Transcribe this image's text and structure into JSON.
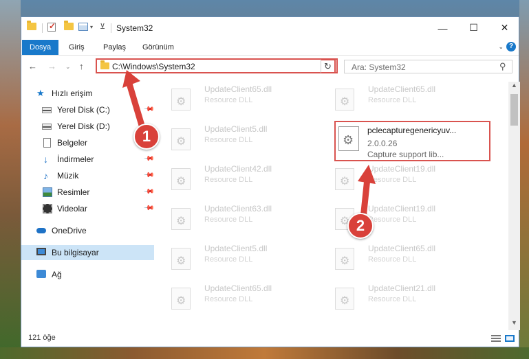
{
  "window": {
    "title": "System32",
    "minimize": "—",
    "maximize": "☐",
    "close": "✕"
  },
  "ribbon": {
    "tabs": [
      "Dosya",
      "Giriş",
      "Paylaş",
      "Görünüm"
    ],
    "help": "?"
  },
  "nav": {
    "address": "C:\\Windows\\System32",
    "search_placeholder": "Ara: System32"
  },
  "sidebar": {
    "items": [
      {
        "label": "Hızlı erişim",
        "icon": "star-icon"
      },
      {
        "label": "Yerel Disk (C:)",
        "icon": "drive-icon",
        "pinned": true
      },
      {
        "label": "Yerel Disk (D:)",
        "icon": "drive-icon",
        "pinned": false
      },
      {
        "label": "Belgeler",
        "icon": "document-icon",
        "pinned": false
      },
      {
        "label": "İndirmeler",
        "icon": "download-icon",
        "pinned": true
      },
      {
        "label": "Müzik",
        "icon": "music-icon",
        "pinned": true
      },
      {
        "label": "Resimler",
        "icon": "pictures-icon",
        "pinned": true
      },
      {
        "label": "Videolar",
        "icon": "videos-icon",
        "pinned": true
      },
      {
        "label": "OneDrive",
        "icon": "cloud-icon"
      },
      {
        "label": "Bu bilgisayar",
        "icon": "computer-icon",
        "selected": true
      },
      {
        "label": "Ağ",
        "icon": "network-icon"
      }
    ]
  },
  "files": {
    "left": [
      {
        "name": "UpdateClient65.dll",
        "type": "Resource DLL"
      },
      {
        "name": "UpdateClient5.dll",
        "type": "Resource DLL"
      },
      {
        "name": "UpdateClient42.dll",
        "type": "Resource DLL"
      },
      {
        "name": "UpdateClient63.dll",
        "type": "Resource DLL"
      },
      {
        "name": "UpdateClient5.dll",
        "type": "Resource DLL"
      },
      {
        "name": "UpdateClient65.dll",
        "type": "Resource DLL"
      }
    ],
    "right": [
      {
        "name": "UpdateClient65.dll",
        "type": "Resource DLL"
      },
      {
        "name": "UpdateClient19.dll",
        "type": "Resource DLL"
      },
      {
        "name": "UpdateClient19.dll",
        "type": "Resource DLL"
      },
      {
        "name": "UpdateClient65.dll",
        "type": "Resource DLL"
      },
      {
        "name": "UpdateClient21.dll",
        "type": "Resource DLL"
      }
    ],
    "highlighted": {
      "name": "pclecapturegenericyuv...",
      "version": "2.0.0.26",
      "description": "Capture support lib..."
    }
  },
  "status": {
    "item_count": "121 öğe"
  },
  "annotations": {
    "step1": "1",
    "step2": "2"
  }
}
